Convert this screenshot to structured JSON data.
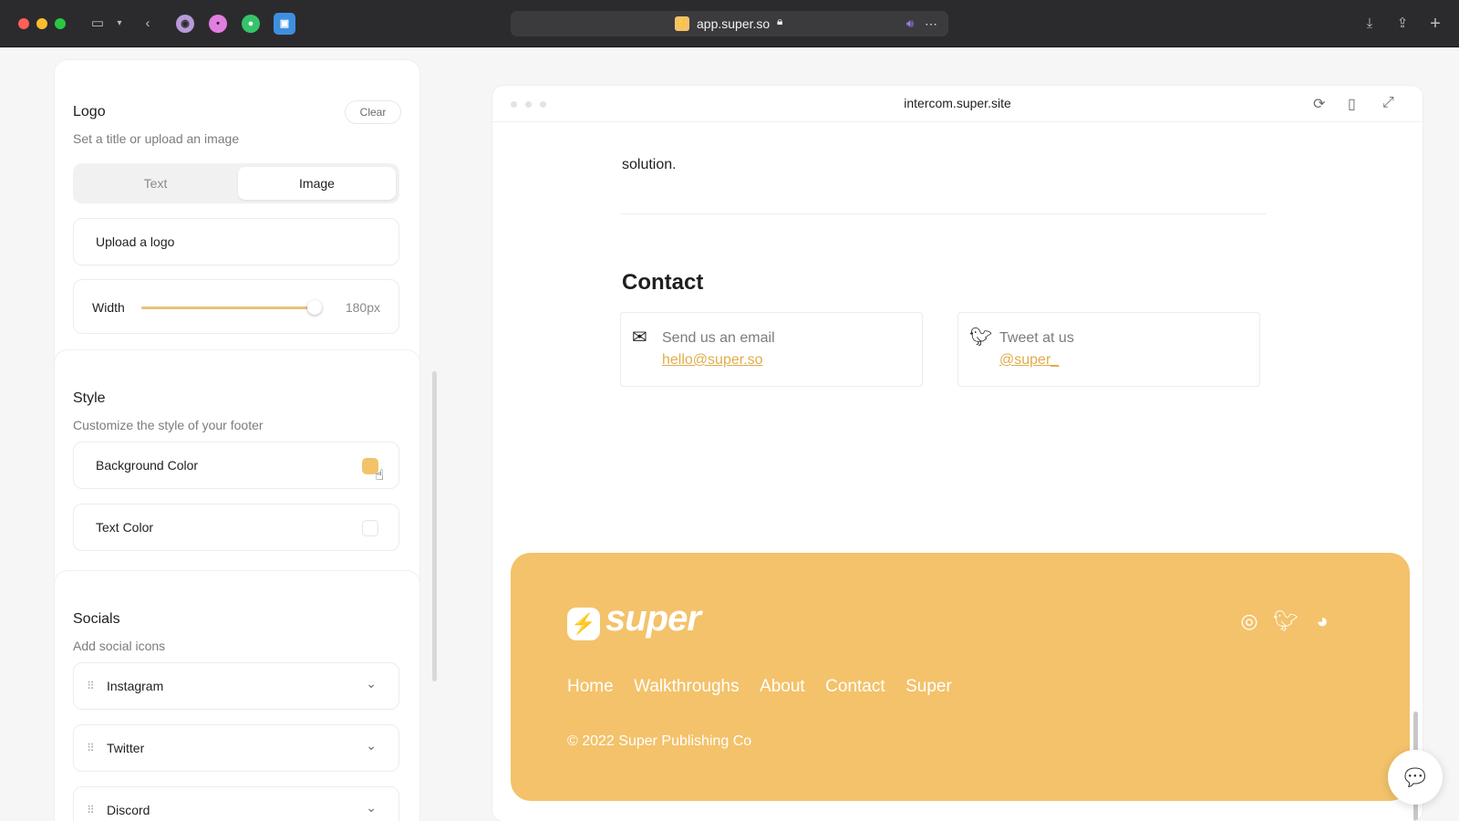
{
  "browser": {
    "url": "app.super.so",
    "icons": [
      "sidebar-icon",
      "back-icon",
      "download-icon",
      "share-icon",
      "new-tab-icon",
      "lock-icon",
      "audio-icon"
    ]
  },
  "logo_card": {
    "title": "Logo",
    "subtitle": "Set a title or upload an image",
    "clear_label": "Clear",
    "segments": [
      "Text",
      "Image"
    ],
    "selected_segment": "Image",
    "upload_label": "Upload a logo",
    "width_label": "Width",
    "width_value": "180px",
    "width_fraction": 0.95
  },
  "style_card": {
    "title": "Style",
    "subtitle": "Customize the style of your footer",
    "bg_color_label": "Background Color",
    "bg_color": "#f3c26a",
    "text_color_label": "Text Color",
    "text_color": "#ffffff"
  },
  "socials_card": {
    "title": "Socials",
    "subtitle": "Add social icons",
    "items": [
      "Instagram",
      "Twitter",
      "Discord"
    ]
  },
  "preview": {
    "url": "intercom.super.site",
    "solution_text": "solution.",
    "contact_heading": "Contact",
    "email_label": "Send us an email",
    "email": "hello@super.so",
    "tweet_label": "Tweet at us",
    "twitter": "@super_",
    "footer": {
      "brand": "super",
      "links": [
        "Home",
        "Walkthroughs",
        "About",
        "Contact",
        "Super"
      ],
      "copyright": "© 2022 Super Publishing Co",
      "bg_color": "#f3c26a"
    }
  }
}
